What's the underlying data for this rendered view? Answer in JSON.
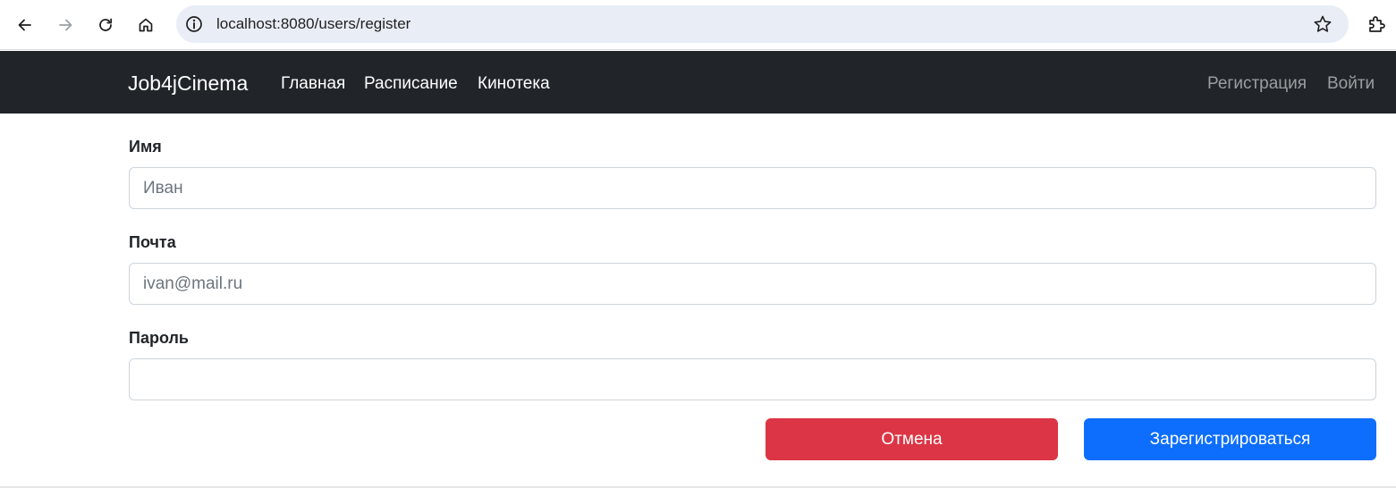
{
  "browser": {
    "url": "localhost:8080/users/register",
    "icons": [
      "back-arrow-icon",
      "forward-arrow-icon",
      "reload-icon",
      "home-icon",
      "info-icon",
      "bookmark-star-icon",
      "extensions-icon"
    ]
  },
  "navbar": {
    "brand": "Job4jCinema",
    "links": [
      {
        "label": "Главная"
      },
      {
        "label": "Расписание"
      },
      {
        "label": "Кинотека"
      }
    ],
    "right_links": [
      {
        "label": "Регистрация"
      },
      {
        "label": "Войти"
      }
    ],
    "background": "#212529"
  },
  "form": {
    "name_label": "Имя",
    "name_placeholder": "Иван",
    "name_value": "",
    "email_label": "Почта",
    "email_placeholder": "ivan@mail.ru",
    "email_value": "",
    "password_label": "Пароль",
    "password_placeholder": "",
    "password_value": "",
    "cancel_label": "Отмена",
    "submit_label": "Зарегистрироваться"
  },
  "colors": {
    "danger": "#dc3545",
    "primary": "#0d6efd"
  }
}
